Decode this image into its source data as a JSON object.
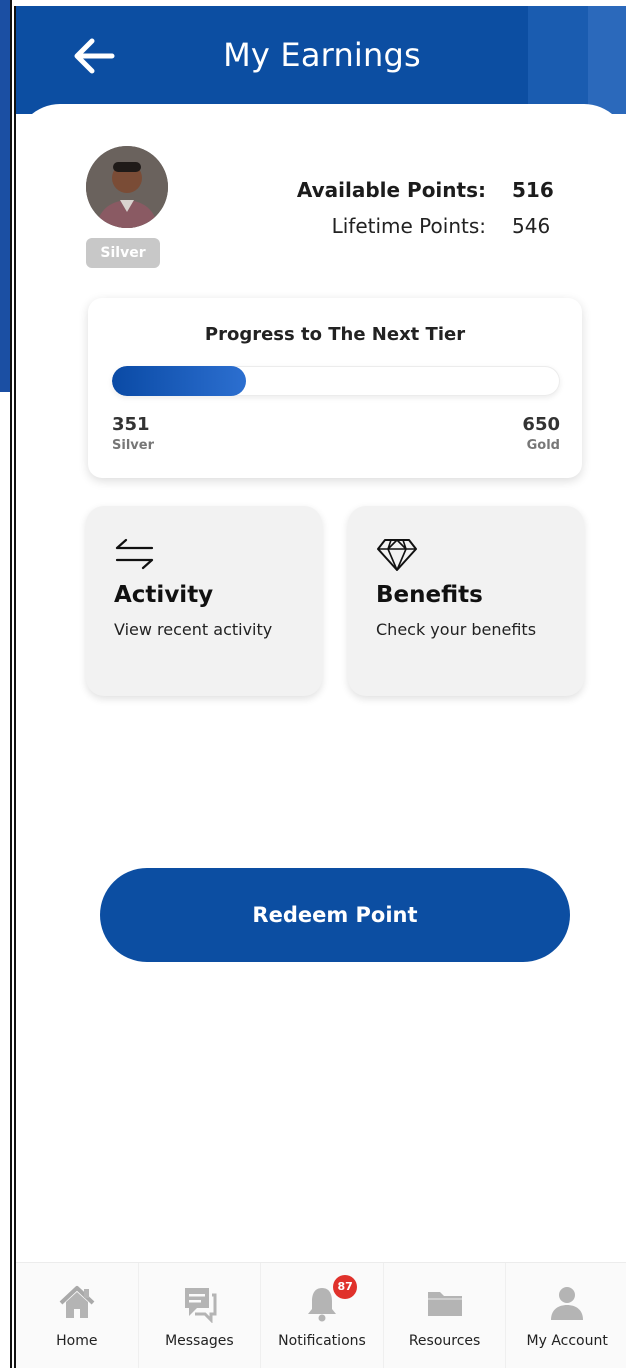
{
  "header": {
    "title": "My Earnings"
  },
  "profile": {
    "tier_badge": "Silver"
  },
  "points": {
    "available_label": "Available Points:",
    "available_value": "516",
    "lifetime_label": "Lifetime Points:",
    "lifetime_value": "546"
  },
  "progress": {
    "title": "Progress to The Next Tier",
    "min_value": "351",
    "min_label": "Silver",
    "max_value": "650",
    "max_label": "Gold",
    "fill_fraction": 0.3
  },
  "tiles": {
    "activity": {
      "label": "Activity",
      "sub": "View recent activity",
      "icon": "swap-arrows-icon"
    },
    "benefits": {
      "label": "Benefits",
      "sub": "Check your benefits",
      "icon": "diamond-icon"
    }
  },
  "redeem_label": "Redeem Point",
  "tabbar": {
    "items": [
      {
        "label": "Home",
        "icon": "home-icon"
      },
      {
        "label": "Messages",
        "icon": "messages-icon"
      },
      {
        "label": "Notifications",
        "icon": "bell-icon"
      },
      {
        "label": "Resources",
        "icon": "folder-icon"
      },
      {
        "label": "My Account",
        "icon": "user-icon"
      }
    ],
    "notification_count": "87"
  },
  "colors": {
    "primary": "#0c4ea2",
    "badge": "#e0312b",
    "tile_bg": "#f2f2f2",
    "tier_badge_bg": "#c8c8c8"
  }
}
